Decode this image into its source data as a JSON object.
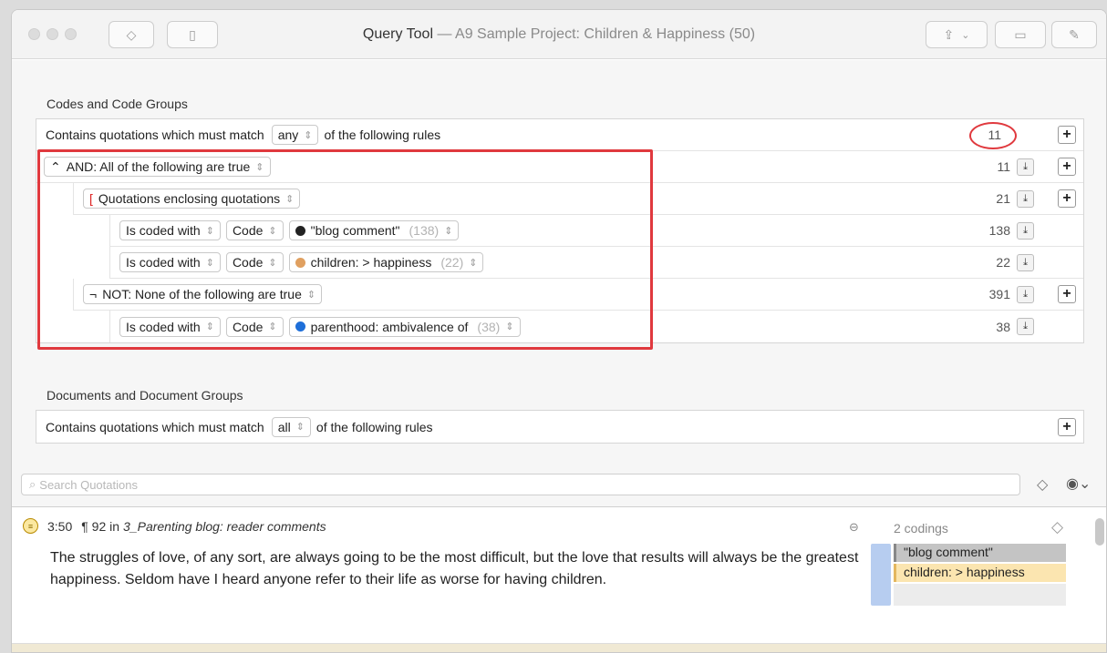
{
  "window": {
    "title": "Query Tool",
    "project": "— A9 Sample Project: Children & Happiness (50)"
  },
  "codes_section": {
    "label": "Codes and Code Groups",
    "header": {
      "prefix": "Contains quotations which must match",
      "match_value": "any",
      "suffix": "of the following rules",
      "count": "11"
    },
    "rules": [
      {
        "operator": "AND: All of the following are true",
        "count": "11"
      },
      {
        "operator": "Quotations enclosing quotations",
        "count": "21"
      },
      {
        "relation": "Is coded with",
        "kind": "Code",
        "code": "\"blog comment\"",
        "code_count": "(138)",
        "color": "#222222",
        "count": "138"
      },
      {
        "relation": "Is coded with",
        "kind": "Code",
        "code": "children: > happiness",
        "code_count": "(22)",
        "color": "#e0a060",
        "count": "22"
      },
      {
        "operator": "NOT: None of the following are true",
        "count": "391"
      },
      {
        "relation": "Is coded with",
        "kind": "Code",
        "code": "parenthood: ambivalence of",
        "code_count": "(38)",
        "color": "#1e6fd9",
        "count": "38"
      }
    ]
  },
  "documents_section": {
    "label": "Documents and Document Groups",
    "header": {
      "prefix": "Contains quotations which must match",
      "match_value": "all",
      "suffix": "of the following rules"
    }
  },
  "search": {
    "placeholder": "Search Quotations"
  },
  "quotation": {
    "id": "3:50",
    "paragraph": "¶ 92 in",
    "document": "3_Parenting blog: reader comments",
    "text": "The struggles of love, of any sort, are always going to be the most difficult, but the love that results will always be the greatest happiness. Seldom have I heard anyone refer to their life as worse for having children.",
    "codings_label": "2 codings",
    "codings": [
      "\"blog comment\"",
      "children: > happiness"
    ]
  },
  "icons": {
    "chevron": "⌃",
    "updown": "⇕"
  }
}
